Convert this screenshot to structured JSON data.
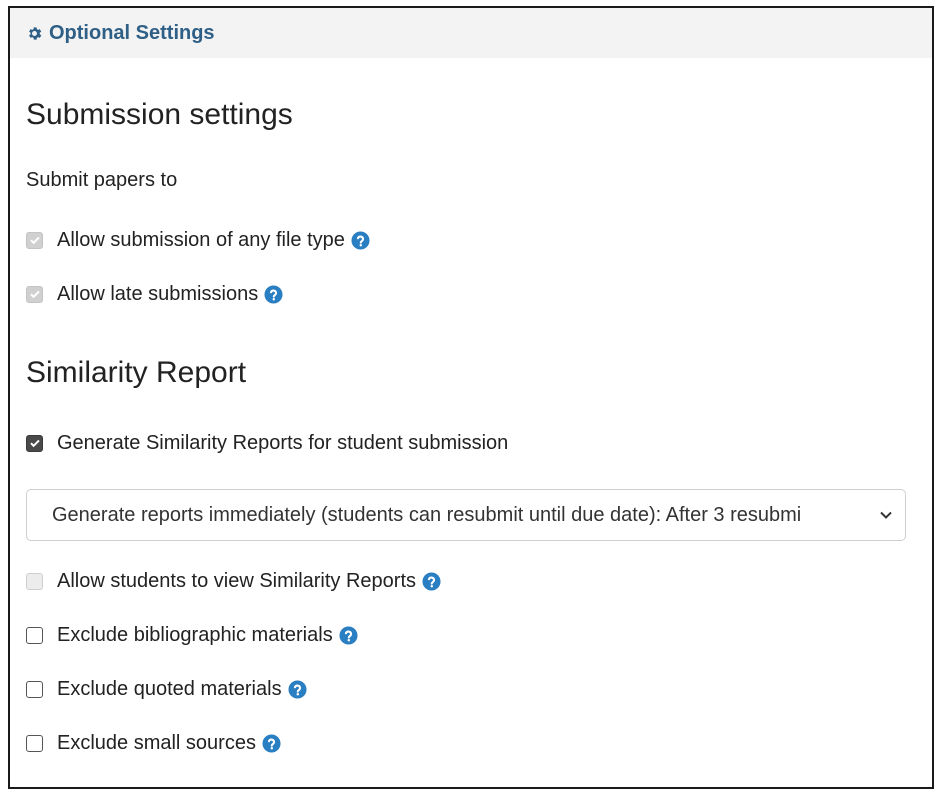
{
  "header": {
    "icon": "gear-icon",
    "title": "Optional Settings"
  },
  "submission_settings": {
    "heading": "Submission settings",
    "submit_to_label": "Submit papers to",
    "allow_any_file_type": {
      "label": "Allow submission of any file type",
      "checked": true,
      "disabled": true,
      "help_icon": "question-circle-icon"
    },
    "allow_late": {
      "label": "Allow late submissions",
      "checked": true,
      "disabled": true,
      "help_icon": "question-circle-icon"
    }
  },
  "similarity_report": {
    "heading": "Similarity Report",
    "generate": {
      "label": "Generate Similarity Reports for student submission",
      "checked": true
    },
    "report_timing_select": {
      "value": "Generate reports immediately (students can resubmit until due date): After 3 resubmi"
    },
    "allow_students_view": {
      "label": "Allow students to view Similarity Reports",
      "checked": false,
      "disabled": true
    },
    "exclude_bibliographic": {
      "label": "Exclude bibliographic materials",
      "checked": false
    },
    "exclude_quoted": {
      "label": "Exclude quoted materials",
      "checked": false
    },
    "exclude_small": {
      "label": "Exclude small sources",
      "checked": false
    }
  },
  "colors": {
    "title": "#2e5f86",
    "help_icon": "#2a7ec2",
    "header_bg": "#f3f3f3"
  }
}
